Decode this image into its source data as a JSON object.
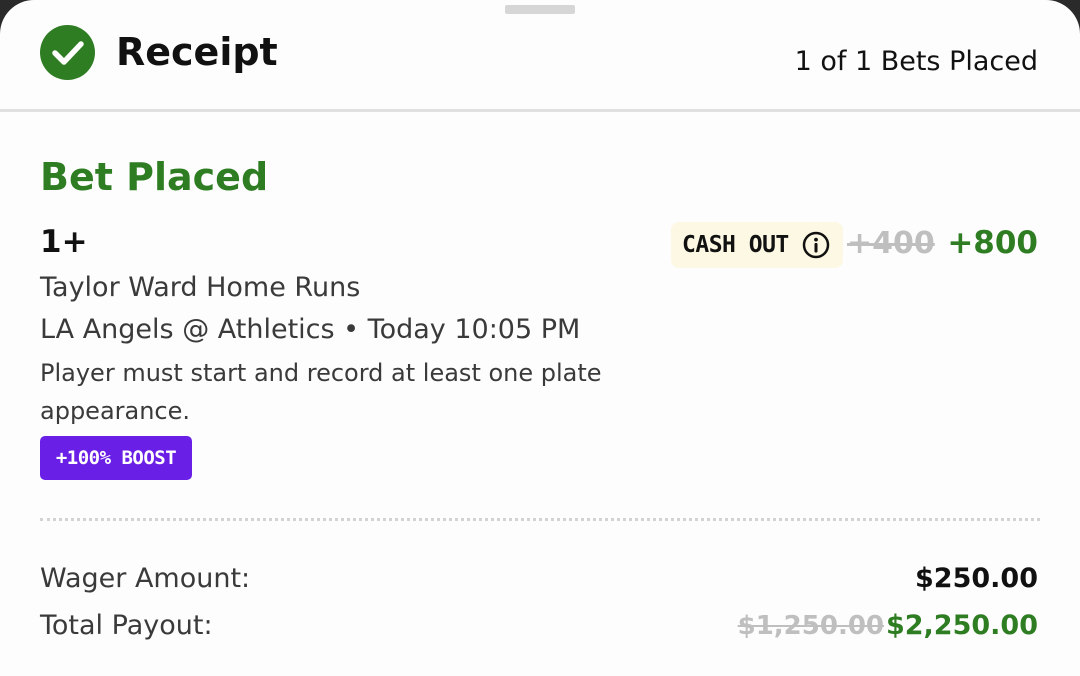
{
  "header": {
    "title": "Receipt",
    "bets_placed": "1 of 1 Bets Placed",
    "status_icon": "check-circle-icon"
  },
  "bet": {
    "status": "Bet Placed",
    "selection": "1+",
    "market": "Taylor Ward Home Runs",
    "event": "LA Angels @ Athletics • Today 10:05 PM",
    "rule": "Player must start and record at least one plate appearance.",
    "boost_label": "+100% BOOST",
    "cash_out_label": "CASH OUT",
    "cash_out_icon": "info-icon",
    "original_odds": "+400",
    "boosted_odds": "+800"
  },
  "summary": {
    "wager_label": "Wager Amount:",
    "wager_value": "$250.00",
    "payout_label": "Total Payout:",
    "original_payout": "$1,250.00",
    "boosted_payout": "$2,250.00"
  },
  "colors": {
    "success_green": "#2e7d22",
    "boost_purple": "#6a1fe6",
    "cash_out_bg": "#fcf8e3",
    "struck_gray": "#bfbfbf"
  }
}
